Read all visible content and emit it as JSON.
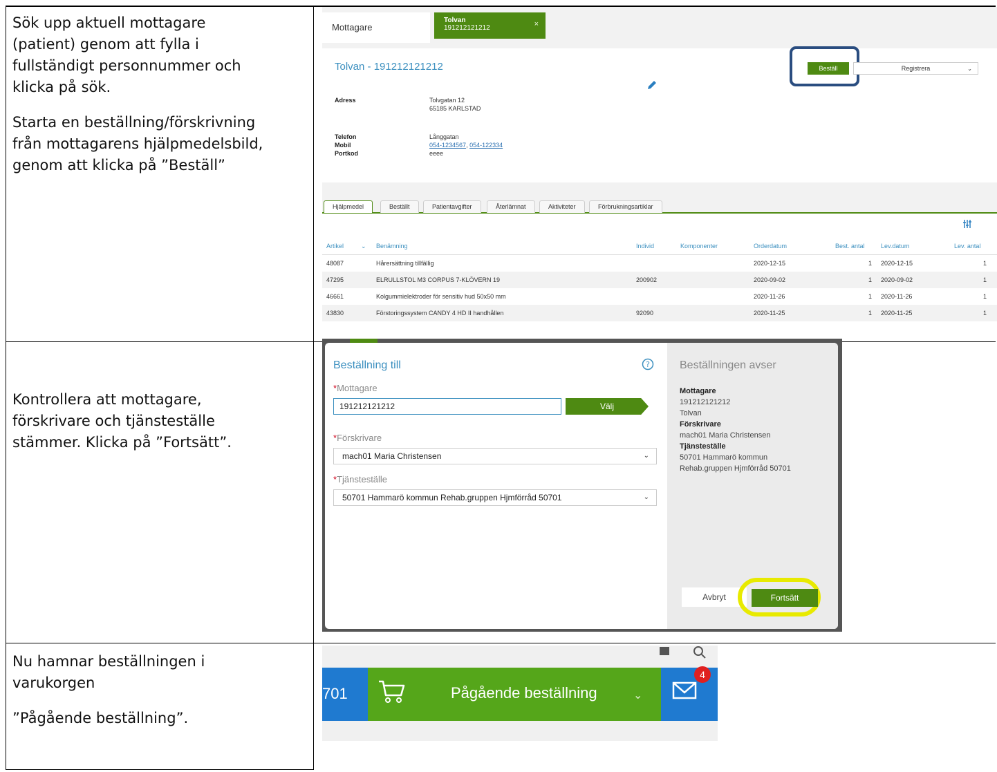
{
  "instructions": {
    "step1_para1": [
      "Sök upp aktuell mottagare",
      "(patient) genom att fylla i",
      "fullständigt personnummer och",
      "klicka på sök."
    ],
    "step1_para2": [
      "Starta en beställning/förskrivning",
      "från mottagarens hjälpmedelsbild,",
      "genom att klicka på ”Beställ”"
    ],
    "step2": [
      "Kontrollera att mottagare,",
      "förskrivare och tjänsteställe",
      "stämmer. Klicka på ”Fortsätt”."
    ],
    "step3_para1": [
      "Nu hamnar beställningen i",
      "varukorgen"
    ],
    "step3_para2": [
      "”Pågående beställning”."
    ]
  },
  "shot1": {
    "tab_plain": "Mottagare",
    "tab_active_name": "Tolvan",
    "tab_active_id": "191212121212",
    "tab_close": "×",
    "patient_title": "Tolvan - 191212121212",
    "order_button": "Beställ",
    "register_select": "Registrera",
    "address_label": "Adress",
    "address_line1": "Tolvgatan 12",
    "address_line2": "65185 KARLSTAD",
    "phone_label": "Telefon",
    "mobile_label": "Mobil",
    "portcode_label": "Portkod",
    "phone_value": "Långgatan",
    "mobile_link1": "054-1234567",
    "mobile_sep": ", ",
    "mobile_link2": "054-122334",
    "portcode_value": "eeee",
    "tabs": [
      "Hjälpmedel",
      "Beställt",
      "Patientavgifter",
      "Återlämnat",
      "Aktiviteter",
      "Förbrukningsartiklar"
    ],
    "columns": [
      "Artikel",
      "Benämning",
      "Individ",
      "Komponenter",
      "Orderdatum",
      "Best. antal",
      "Lev.datum",
      "Lev. antal"
    ],
    "rows": [
      {
        "artikel": "48087",
        "benamning": "Hårersättning tillfällig",
        "individ": "",
        "orderdatum": "2020-12-15",
        "best": "1",
        "levdatum": "2020-12-15",
        "lev": "1"
      },
      {
        "artikel": "47295",
        "benamning": "ELRULLSTOL M3 CORPUS 7-KLÖVERN 19",
        "individ": "200902",
        "orderdatum": "2020-09-02",
        "best": "1",
        "levdatum": "2020-09-02",
        "lev": "1"
      },
      {
        "artikel": "46661",
        "benamning": "Kolgummielektroder för sensitiv hud 50x50 mm",
        "individ": "",
        "orderdatum": "2020-11-26",
        "best": "1",
        "levdatum": "2020-11-26",
        "lev": "1"
      },
      {
        "artikel": "43830",
        "benamning": "Förstoringssystem CANDY 4 HD II handhållen",
        "individ": "92090",
        "orderdatum": "2020-11-25",
        "best": "1",
        "levdatum": "2020-11-25",
        "lev": "1"
      }
    ]
  },
  "shot2": {
    "title": "Beställning till",
    "mottagare_label": "Mottagare",
    "mottagare_value": "191212121212",
    "valj_button": "Välj",
    "forskrivare_label": "Förskrivare",
    "forskrivare_value": "mach01 Maria Christensen",
    "tjanst_label": "Tjänsteställe",
    "tjanst_value": "50701 Hammarö kommun Rehab.gruppen Hjmförråd 50701",
    "required_mark": "*",
    "summary_title": "Beställningen avser",
    "summary": {
      "mottagare_h": "Mottagare",
      "mottagare_id": "191212121212",
      "mottagare_name": "Tolvan",
      "forskrivare_h": "Förskrivare",
      "forskrivare_v": "mach01 Maria Christensen",
      "tjanst_h": "Tjänsteställe",
      "tjanst_v1": "50701 Hammarö kommun",
      "tjanst_v2": "Rehab.gruppen Hjmförråd 50701"
    },
    "cancel_button": "Avbryt",
    "continue_button": "Fortsätt"
  },
  "shot3": {
    "left_number": "701",
    "cart_label": "Pågående beställning",
    "mail_badge": "4"
  },
  "colors": {
    "accent_green": "#4e8a12",
    "link_blue": "#3b8fbf",
    "callout_blue": "#2a4d80",
    "highlight_yellow": "#e8ea00",
    "bar_blue": "#1f7ad0"
  }
}
